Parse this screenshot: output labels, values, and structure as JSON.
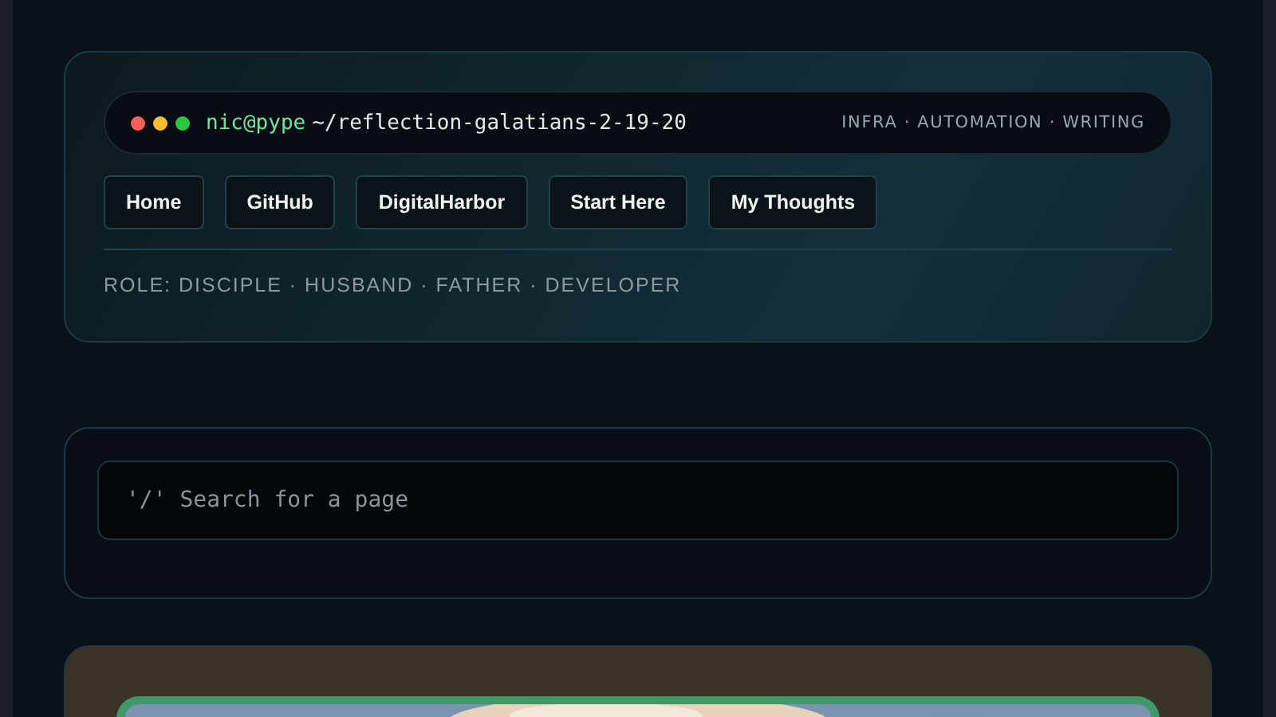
{
  "terminal": {
    "dots": [
      {
        "color": "#ff5f57"
      },
      {
        "color": "#febc2e"
      },
      {
        "color": "#28c840"
      }
    ],
    "user": "nic@pype",
    "path": "~/reflection-galatians-2-19-20",
    "tagline": "INFRA · AUTOMATION · WRITING"
  },
  "nav": [
    "Home",
    "GitHub",
    "DigitalHarbor",
    "Start Here",
    "My Thoughts"
  ],
  "role": "ROLE: DISCIPLE · HUSBAND · FATHER · DEVELOPER",
  "search": {
    "placeholder": "'/' Search for a page"
  }
}
